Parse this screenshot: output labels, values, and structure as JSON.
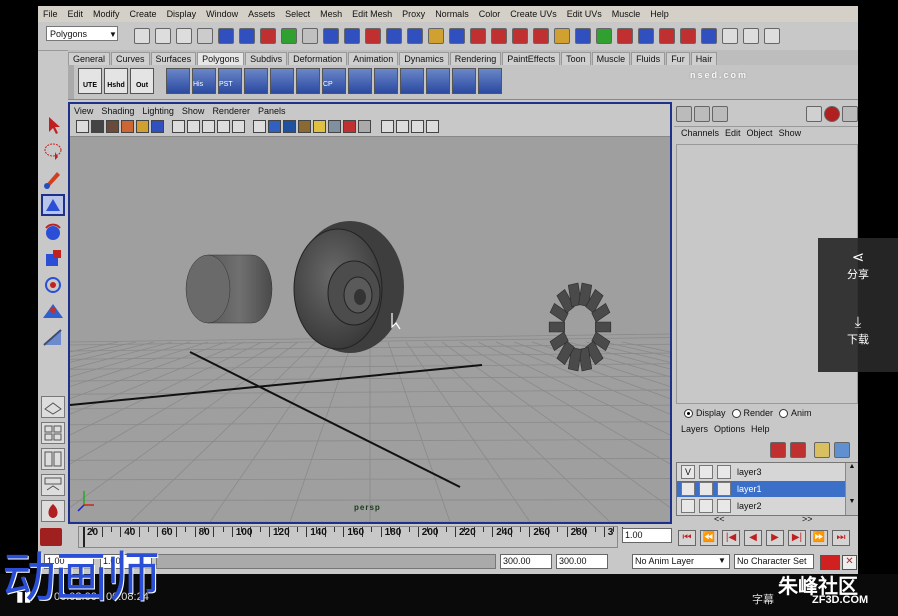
{
  "menubar": [
    "File",
    "Edit",
    "Modify",
    "Create",
    "Display",
    "Window",
    "Assets",
    "Select",
    "Mesh",
    "Edit Mesh",
    "Proxy",
    "Normals",
    "Color",
    "Create UVs",
    "Edit UVs",
    "Muscle",
    "Help"
  ],
  "status_line": {
    "mode": "Polygons"
  },
  "shelf_tabs": [
    "General",
    "Curves",
    "Surfaces",
    "Polygons",
    "Subdivs",
    "Deformation",
    "Animation",
    "Dynamics",
    "Rendering",
    "PaintEffects",
    "Toon",
    "Muscle",
    "Fluids",
    "Fur",
    "Hair"
  ],
  "shelf_buttons": [
    "UTE",
    "Hshd",
    "Out",
    "",
    "His",
    "PST",
    "",
    "",
    "",
    "CP",
    "",
    "",
    "",
    "",
    "",
    ""
  ],
  "watermark_top": "nsed.com",
  "viewport": {
    "menu": [
      "View",
      "Shading",
      "Lighting",
      "Show",
      "Renderer",
      "Panels"
    ],
    "camera_label": "persp"
  },
  "channel_box": {
    "menu": [
      "Channels",
      "Edit",
      "Object",
      "Show"
    ]
  },
  "layer_editor": {
    "tabs": [
      {
        "label": "Display",
        "selected": true
      },
      {
        "label": "Render",
        "selected": false
      },
      {
        "label": "Anim",
        "selected": false
      }
    ],
    "menu": [
      "Layers",
      "Options",
      "Help"
    ],
    "layers": [
      {
        "name": "layer3",
        "visible": "V",
        "selected": false
      },
      {
        "name": "layer1",
        "visible": "",
        "selected": true
      },
      {
        "name": "layer2",
        "visible": "",
        "selected": false
      }
    ],
    "scroll_arrows": [
      "<<",
      ">>"
    ]
  },
  "time_slider": {
    "ticks": [
      "20",
      "40",
      "60",
      "80",
      "100",
      "120",
      "140",
      "160",
      "180",
      "200",
      "220",
      "240",
      "260",
      "280",
      "3"
    ],
    "current_time": "1.00"
  },
  "range_slider": {
    "start": "1.00",
    "inner_start": "1.00",
    "end_inner": "300.00",
    "end": "300.00",
    "anim_layer": "No Anim Layer",
    "character_set": "No Character Set"
  },
  "overlay": {
    "share_label": "分享",
    "download_label": "下载"
  },
  "player": {
    "time": "00:02:00 / 00:08:24",
    "subtitle_label": "字幕"
  },
  "captions": {
    "left_logo": "动画师",
    "right_logo": "朱峰社区",
    "right_url": "ZF3D.COM"
  },
  "colors": {
    "viewport_border": "#1e2f8c",
    "selection": "#3c6fc8",
    "logo_blue": "#2a4fd6"
  }
}
